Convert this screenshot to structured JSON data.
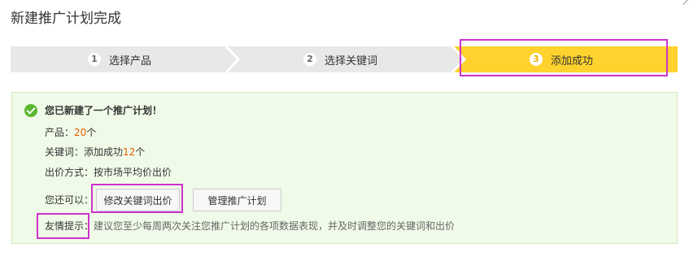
{
  "page": {
    "title": "新建推广计划完成"
  },
  "steps": [
    {
      "number": "1",
      "label": "选择产品",
      "state": "done"
    },
    {
      "number": "2",
      "label": "选择关键词",
      "state": "done"
    },
    {
      "number": "3",
      "label": "添加成功",
      "state": "active"
    }
  ],
  "colors": {
    "step_inactive": "#e8e8e8",
    "step_active": "#ffd22e",
    "success": "#59b82f",
    "highlight": "#e65c00",
    "annotation": "#cc33cc"
  },
  "result": {
    "title": "您已新建了一个推广计划！",
    "product_label": "产品：",
    "product_count": "20",
    "product_unit": "个",
    "keyword_label": "关键词：添加成功",
    "keyword_count": "12",
    "keyword_unit": "个",
    "bid_label": "出价方式：按市场平均价出价",
    "also_label": "您还可以：",
    "edit_button": "修改关键词出价",
    "manage_button": "管理推广计划",
    "tip_label": "友情提示：",
    "tip_text": "建议您至少每周两次关注您推广计划的各项数据表现，并及时调整您的关键词和出价"
  }
}
